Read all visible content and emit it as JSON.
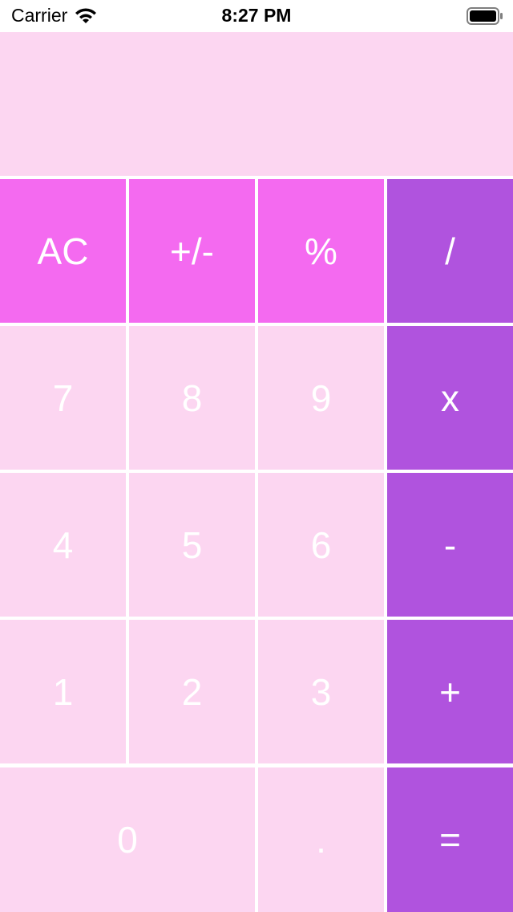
{
  "status_bar": {
    "carrier": "Carrier",
    "time": "8:27 PM",
    "wifi_icon": "wifi-icon",
    "battery_icon": "battery-full-icon"
  },
  "display": {
    "value": ""
  },
  "colors": {
    "function_key": "#f46af0",
    "operator_key": "#b053de",
    "number_key": "#fcd6f1",
    "display_bg": "#fcd6f1",
    "key_text": "#ffffff"
  },
  "keys": {
    "ac": "AC",
    "plus_minus": "+/-",
    "percent": "%",
    "divide": "/",
    "seven": "7",
    "eight": "8",
    "nine": "9",
    "multiply": "x",
    "four": "4",
    "five": "5",
    "six": "6",
    "subtract": "-",
    "one": "1",
    "two": "2",
    "three": "3",
    "add": "+",
    "zero": "0",
    "decimal": ".",
    "equals": "="
  }
}
